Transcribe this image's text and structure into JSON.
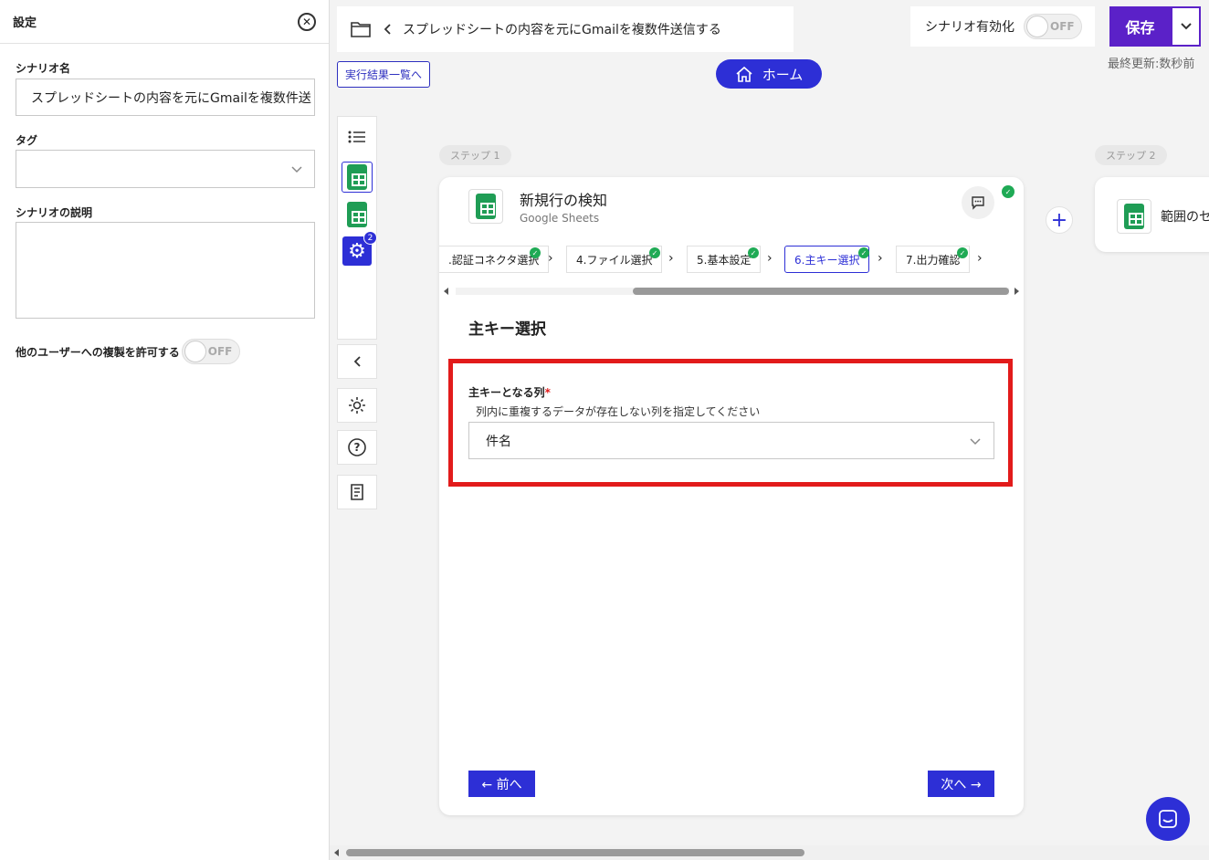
{
  "settings": {
    "title": "設定",
    "scenario_name_label": "シナリオ名",
    "scenario_name_value": "スプレッドシートの内容を元にGmailを複数件送",
    "tag_label": "タグ",
    "description_label": "シナリオの説明",
    "allow_copy_label": "他のユーザーへの複製を許可する",
    "allow_copy_toggle": "OFF"
  },
  "header": {
    "scenario_title": "スプレッドシートの内容を元にGmailを複数件送信する",
    "results_link": "実行結果一覧へ",
    "home_button": "ホーム",
    "activate_label": "シナリオ有効化",
    "activate_toggle": "OFF",
    "save_button": "保存",
    "last_updated": "最終更新:数秒前"
  },
  "toolbar": {
    "settings_badge": "2"
  },
  "steps": {
    "step1_label": "ステップ 1",
    "step2_label": "ステップ 2"
  },
  "card": {
    "title": "新規行の検知",
    "subtitle": "Google Sheets",
    "tabs": [
      {
        "label": ".認証コネクタ選択"
      },
      {
        "label": "4.ファイル選択"
      },
      {
        "label": "5.基本設定"
      },
      {
        "label": "6.主キー選択"
      },
      {
        "label": "7.出力確認"
      }
    ],
    "section_title": "主キー選択",
    "primary_key_label": "主キーとなる列",
    "required_mark": "*",
    "primary_key_help": "列内に重複するデータが存在しない列を指定してください",
    "primary_key_value": "件名",
    "prev_button": "← 前へ",
    "next_button": "次へ →"
  },
  "card2": {
    "title": "範囲のセ"
  },
  "colors": {
    "accent": "#2d2fd6",
    "save": "#5b21c8",
    "highlight": "#e21b1b",
    "success": "#1faa55"
  }
}
